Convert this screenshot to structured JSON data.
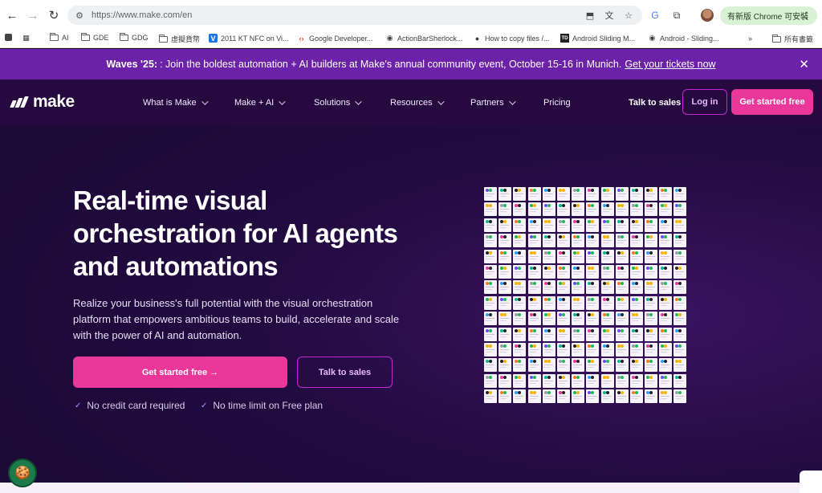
{
  "browser": {
    "url_host": "https://www.make.com",
    "url_path": "/en",
    "update_label": "有新版 Chrome 可安裝"
  },
  "bookmarks": [
    {
      "label": "AI",
      "icon": "folder-icon"
    },
    {
      "label": "GDE",
      "icon": "folder-icon"
    },
    {
      "label": "GDG",
      "icon": "folder-icon"
    },
    {
      "label": "虛擬貨幣",
      "icon": "folder-icon"
    },
    {
      "label": "2011 KT NFC on Vi...",
      "icon": "v-icon"
    },
    {
      "label": "Google Developer...",
      "icon": "google-dev-icon"
    },
    {
      "label": "ActionBarSherlock...",
      "icon": "globe-icon"
    },
    {
      "label": "How to copy files /...",
      "icon": "github-icon"
    },
    {
      "label": "Android Sliding M...",
      "icon": "td-icon"
    },
    {
      "label": "Android - Sliding...",
      "icon": "globe-icon"
    },
    {
      "label": "所有書籤",
      "icon": "folder-icon"
    }
  ],
  "promo": {
    "bold": "Waves '25:",
    "text": ": Join the boldest automation + AI builders at Make's annual community event, October 15-16 in Munich.",
    "link": "Get your tickets now"
  },
  "nav": {
    "logo": "make",
    "items": [
      "What is Make",
      "Make + AI",
      "Solutions",
      "Resources",
      "Partners",
      "Pricing"
    ],
    "talk": "Talk to sales",
    "login": "Log in",
    "started": "Get started free"
  },
  "hero": {
    "title": "Real-time visual orchestration for AI agents and automations",
    "subtitle": "Realize your business's full potential with the visual orchestration platform that empowers ambitious teams to build, accelerate and scale with the power of AI and automation.",
    "primary_cta": "Get started free →",
    "secondary_cta": "Talk to sales",
    "checks": [
      "No credit card required",
      "No time limit on Free plan"
    ]
  },
  "colors": {
    "brand_purple": "#6b21a8",
    "accent_pink": "#e9389a",
    "background": "#1a0832"
  }
}
